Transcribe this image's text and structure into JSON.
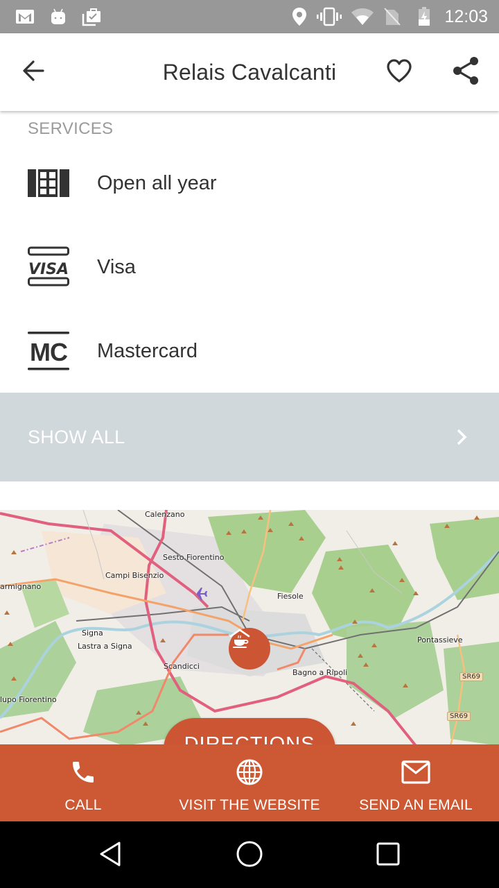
{
  "status_bar": {
    "left_icons": [
      "gmail-icon",
      "android-icon",
      "task-check-icon"
    ],
    "right_icons": [
      "location-icon",
      "vibrate-icon",
      "wifi-icon",
      "no-sim-icon",
      "battery-charging-icon"
    ],
    "time": "12:03"
  },
  "app_bar": {
    "title": "Relais Cavalcanti",
    "back_icon": "arrow-back-icon",
    "favorite_icon": "heart-outline-icon",
    "share_icon": "share-icon"
  },
  "services": {
    "header": "SERVICES",
    "items": [
      {
        "label": "Open all year",
        "icon": "calendar-grid-icon"
      },
      {
        "label": "Visa",
        "icon": "visa-icon"
      },
      {
        "label": "Mastercard",
        "icon": "mastercard-icon"
      }
    ],
    "show_all_label": "SHOW ALL"
  },
  "map": {
    "places": [
      "Calenzano",
      "Sesto Fiorentino",
      "Campi Bisenzio",
      "armignano",
      "Fiesole",
      "Signa",
      "Lastra a Signa",
      "Scandicci",
      "Pontassieve",
      "Bagno a Ripoli",
      "lupo Fiorentino"
    ],
    "road_shields": [
      "SR69",
      "SR69"
    ],
    "marker_icon": "coffee-house-icon",
    "directions_label": "DIRECTIONS"
  },
  "actions": [
    {
      "label": "CALL",
      "icon": "phone-icon"
    },
    {
      "label": "VISIT THE WEBSITE",
      "icon": "globe-icon"
    },
    {
      "label": "SEND AN EMAIL",
      "icon": "mail-icon"
    }
  ],
  "colors": {
    "accent": "#cc5934",
    "show_all_bg": "#d0d8dc",
    "status_bar": "#989898"
  }
}
